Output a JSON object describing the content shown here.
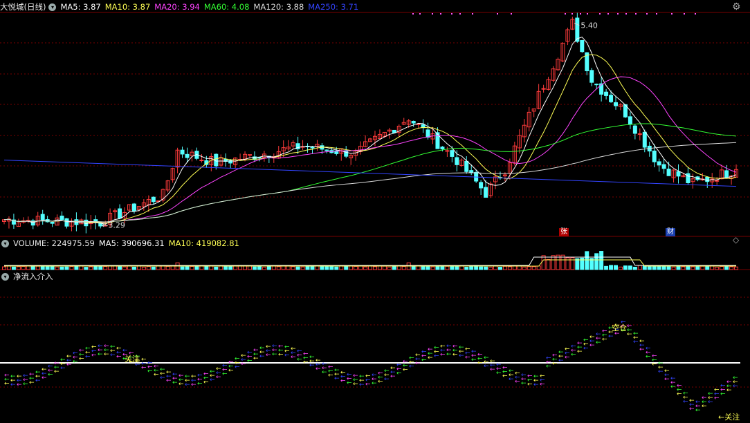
{
  "header": {
    "stock_title": "大悦城(日线)",
    "ma_indicators": [
      {
        "label": "MA5: 3.87",
        "color": "#ffffff"
      },
      {
        "label": "MA10: 3.87",
        "color": "#ffff55"
      },
      {
        "label": "MA20: 3.94",
        "color": "#ff44ff"
      },
      {
        "label": "MA60: 4.08",
        "color": "#33ff33"
      },
      {
        "label": "MA120: 3.88",
        "color": "#dddddd"
      },
      {
        "label": "MA250: 3.71",
        "color": "#3344ff"
      }
    ]
  },
  "volume_header": {
    "volume": "VOLUME: 224975.59",
    "ma5": "MA5: 390696.31",
    "ma10": "MA10: 419082.81"
  },
  "indicator_header": {
    "name": "净流入介入"
  },
  "annotations": {
    "high_label": "5.40",
    "low_label": "3.29",
    "zhang_badge": "张",
    "cai_badge": "财",
    "guanzhu_left": "关注",
    "guanzhu_right": "关注",
    "kongcang": "空仓"
  },
  "colors": {
    "up": "#ff3b3b",
    "down": "#54ffff",
    "grid": "#7a0000",
    "ma5": "#ffffff",
    "ma10": "#ffff55",
    "ma20": "#ff44ff",
    "ma60": "#33ff33",
    "ma120": "#dddddd",
    "ma250": "#3344ff"
  },
  "chart_data": {
    "type": "candlestick",
    "price_range": [
      3.2,
      5.5
    ],
    "price_anchors": [
      {
        "candle": 0,
        "close": 3.32
      },
      {
        "candle": 20,
        "close": 3.29
      },
      {
        "candle": 33,
        "close": 3.58
      },
      {
        "candle": 36,
        "close": 4.05
      },
      {
        "candle": 44,
        "close": 3.92
      },
      {
        "candle": 62,
        "close": 4.1
      },
      {
        "candle": 73,
        "close": 4.02
      },
      {
        "candle": 84,
        "close": 4.4
      },
      {
        "candle": 94,
        "close": 3.95
      },
      {
        "candle": 100,
        "close": 3.6
      },
      {
        "candle": 104,
        "close": 3.85
      },
      {
        "candle": 112,
        "close": 4.75
      },
      {
        "candle": 118,
        "close": 5.4
      },
      {
        "candle": 122,
        "close": 4.8
      },
      {
        "candle": 129,
        "close": 4.45
      },
      {
        "candle": 136,
        "close": 3.9
      },
      {
        "candle": 143,
        "close": 3.7
      },
      {
        "candle": 152,
        "close": 3.85
      }
    ],
    "candle_count": 153,
    "volume_series": {
      "last": 224975.59,
      "ma5": 390696.31,
      "ma10": 419082.81
    },
    "indicator": {
      "name": "净流入介入",
      "zero_line": true
    }
  }
}
